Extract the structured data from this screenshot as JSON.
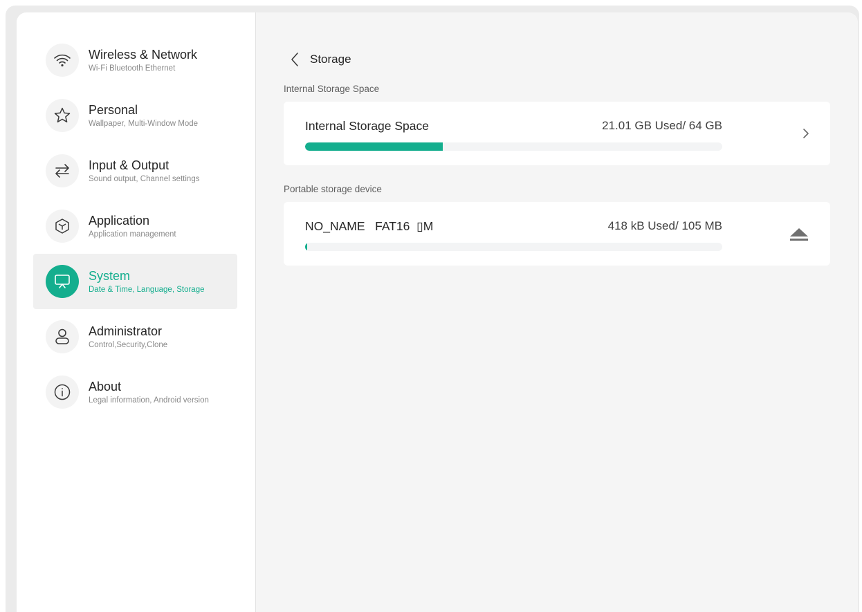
{
  "sidebar": {
    "items": [
      {
        "title": "Wireless & Network",
        "subtitle": "Wi-Fi Bluetooth Ethernet",
        "icon": "wifi-icon"
      },
      {
        "title": "Personal",
        "subtitle": "Wallpaper, Multi-Window Mode",
        "icon": "star-icon"
      },
      {
        "title": "Input & Output",
        "subtitle": "Sound output, Channel settings",
        "icon": "swap-icon"
      },
      {
        "title": "Application",
        "subtitle": "Application management",
        "icon": "cube-icon"
      },
      {
        "title": "System",
        "subtitle": "Date & Time, Language, Storage",
        "icon": "presentation-icon",
        "active": true
      },
      {
        "title": "Administrator",
        "subtitle": "Control,Security,Clone",
        "icon": "user-icon"
      },
      {
        "title": "About",
        "subtitle": "Legal information, Android version",
        "icon": "info-icon"
      }
    ]
  },
  "header": {
    "title": "Storage",
    "back_icon": "chevron-left-icon"
  },
  "internal": {
    "section_label": "Internal Storage Space",
    "name": "Internal Storage Space",
    "usage": "21.01 GB Used/ 64 GB",
    "used_fraction": 0.33,
    "action_icon": "chevron-right-icon"
  },
  "portable": {
    "section_label": "Portable storage device",
    "name": "NO_NAME   FAT16  ▯M",
    "usage": "418 kB Used/ 105 MB",
    "used_fraction": 0.004,
    "action_icon": "eject-icon"
  },
  "colors": {
    "accent": "#14ae8e",
    "text_primary": "#262626",
    "text_secondary": "#8a8a8a"
  }
}
